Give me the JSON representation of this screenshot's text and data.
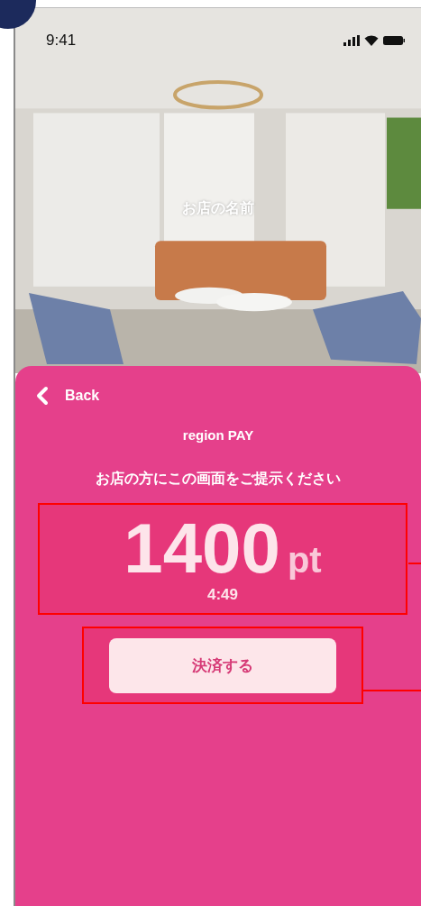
{
  "status_bar": {
    "time": "9:41"
  },
  "hero": {
    "kind": "picture",
    "store_name": "お店の名前"
  },
  "sheet": {
    "back": "Back",
    "title": "region PAY",
    "instruction": "お店の方にこの画面をご提示ください",
    "amount": "1400",
    "unit": "pt",
    "timer": "4:49",
    "pay_button": "決済する"
  }
}
